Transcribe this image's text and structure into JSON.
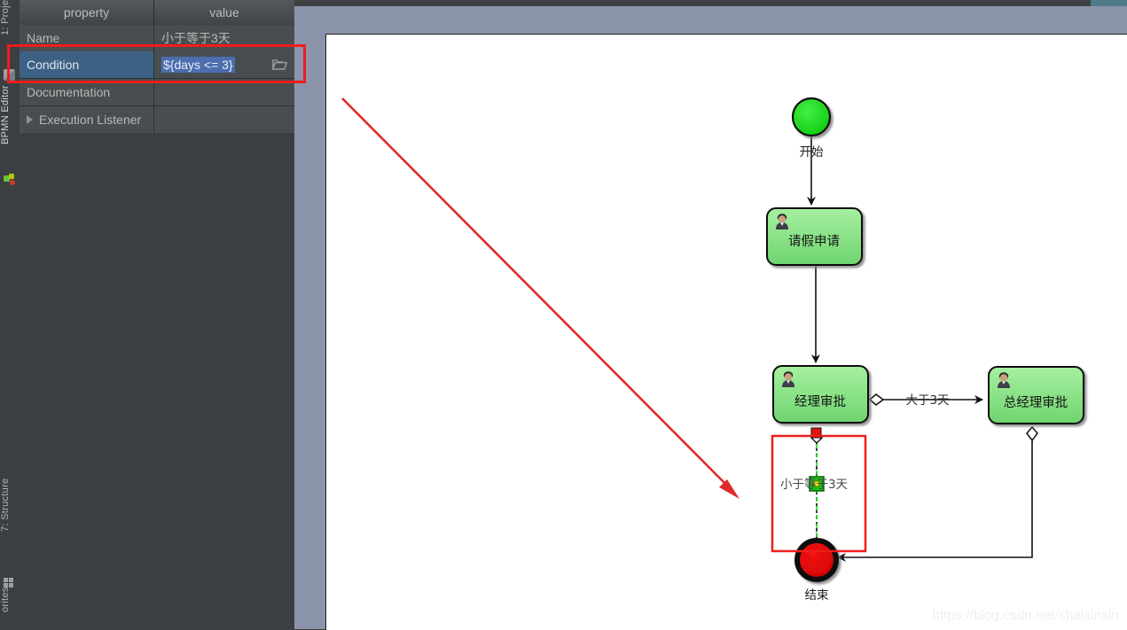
{
  "toolbar": {
    "tabs": [
      {
        "label": "1: Proje",
        "icon": "project-icon"
      },
      {
        "label": "BPMN Editor",
        "icon": "bpmn-icon"
      },
      {
        "label": "7: Structure",
        "icon": "structure-icon"
      },
      {
        "label": "orites",
        "icon": "favorites-icon"
      }
    ]
  },
  "properties": {
    "headers": {
      "property": "property",
      "value": "value"
    },
    "rows": [
      {
        "key": "Name",
        "value": "小于等于3天",
        "selected": false,
        "expandable": false,
        "browse": false
      },
      {
        "key": "Condition",
        "value": "${days <= 3}",
        "selected": true,
        "expandable": false,
        "browse": true
      },
      {
        "key": "Documentation",
        "value": "",
        "selected": false,
        "expandable": false,
        "browse": false
      },
      {
        "key": "Execution Listener",
        "value": "",
        "selected": false,
        "expandable": true,
        "browse": false
      }
    ]
  },
  "diagram": {
    "start_event": {
      "label": "开始"
    },
    "end_event": {
      "label": "结束"
    },
    "tasks": [
      {
        "label": "请假申请"
      },
      {
        "label": "经理审批"
      },
      {
        "label": "总经理审批"
      }
    ],
    "flows": [
      {
        "label": "大于3天",
        "selected": false
      },
      {
        "label": "小于等于3天",
        "selected": true
      }
    ]
  },
  "watermark": "https://blog.csdn.net/shaixinxin",
  "colors": {
    "accent_selection": "#4b6eaf",
    "annotation_red": "#f01d1d",
    "task_green": "#84e184",
    "start_green": "#1ed81e",
    "end_red": "#e00000",
    "panel_blue_gray": "#8b94ab"
  }
}
